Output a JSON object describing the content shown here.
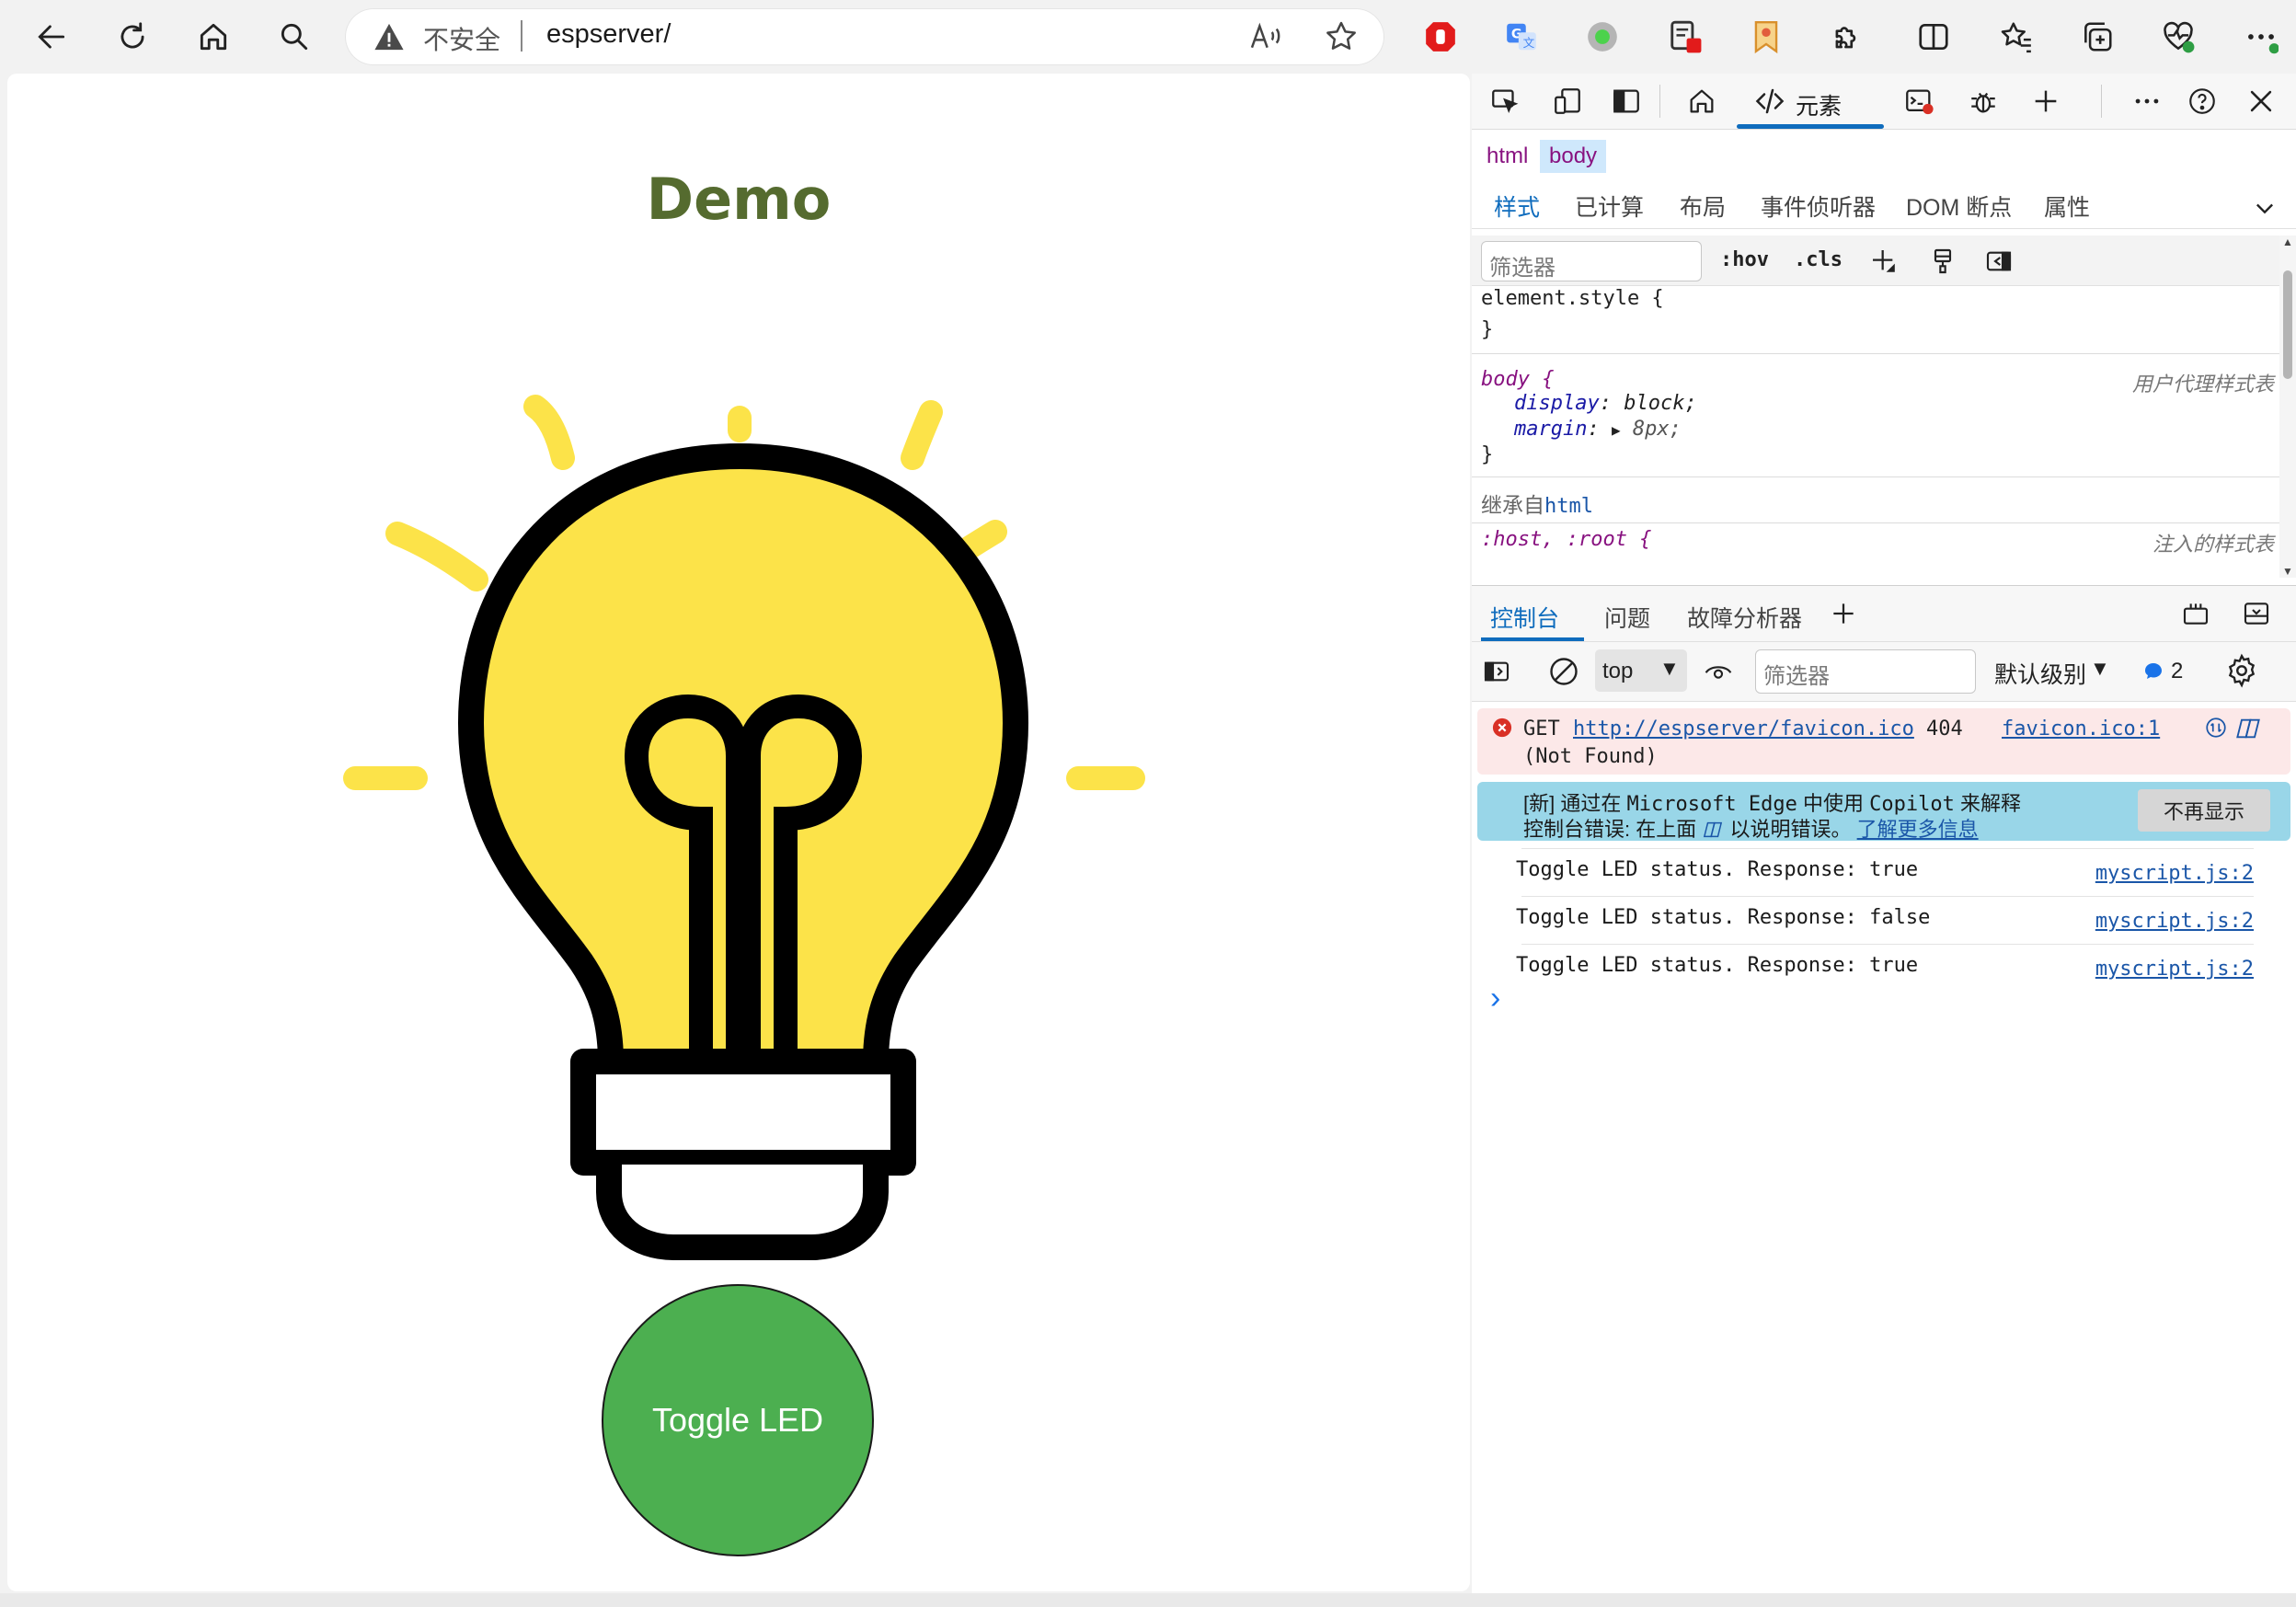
{
  "browser": {
    "security_label": "不安全",
    "url": "espserver/"
  },
  "page": {
    "title": "Demo",
    "button_label": "Toggle LED",
    "bulb_color": "#fce349",
    "button_color": "#4caf50",
    "title_color": "#556b2f"
  },
  "devtools": {
    "elements_tab": "元素",
    "breadcrumb": [
      "html",
      "body"
    ],
    "style_tabs": [
      "样式",
      "已计算",
      "布局",
      "事件侦听器",
      "DOM 断点",
      "属性"
    ],
    "filter_placeholder": "筛选器",
    "hov": ":hov",
    "cls": ".cls",
    "styles": {
      "element_style": "element.style {",
      "close_brace": "}",
      "body_selector": "body {",
      "ua_label": "用户代理样式表",
      "display_prop": "display",
      "display_val": "block;",
      "margin_prop": "margin",
      "margin_val": "8px;",
      "inherited_label": "继承自",
      "inherited_from": "html",
      "host_selector": ":host, :root {",
      "injected_label": "注入的样式表"
    },
    "drawer_tabs": [
      "控制台",
      "问题",
      "故障分析器"
    ],
    "console": {
      "context": "top",
      "filter_placeholder": "筛选器",
      "level": "默认级别",
      "message_count": "2",
      "error": {
        "method": "GET",
        "url": "http://espserver/favicon.ico",
        "status": "404",
        "status_text": "(Not Found)",
        "source": "favicon.ico:1"
      },
      "copilot": {
        "line1_a": "[新] 通过在",
        "line1_b": "Microsoft Edge",
        "line1_c": "中使用",
        "line1_d": "Copilot",
        "line1_e": "来解释",
        "line2_a": "控制台错误: 在上面",
        "line2_b": "以说明错误。",
        "learn_more": "了解更多信息",
        "dismiss": "不再显示"
      },
      "logs": [
        {
          "text": "Toggle LED status. Response: true",
          "source": "myscript.js:2"
        },
        {
          "text": "Toggle LED status. Response: false",
          "source": "myscript.js:2"
        },
        {
          "text": "Toggle LED status. Response: true",
          "source": "myscript.js:2"
        }
      ],
      "prompt": "›"
    }
  }
}
